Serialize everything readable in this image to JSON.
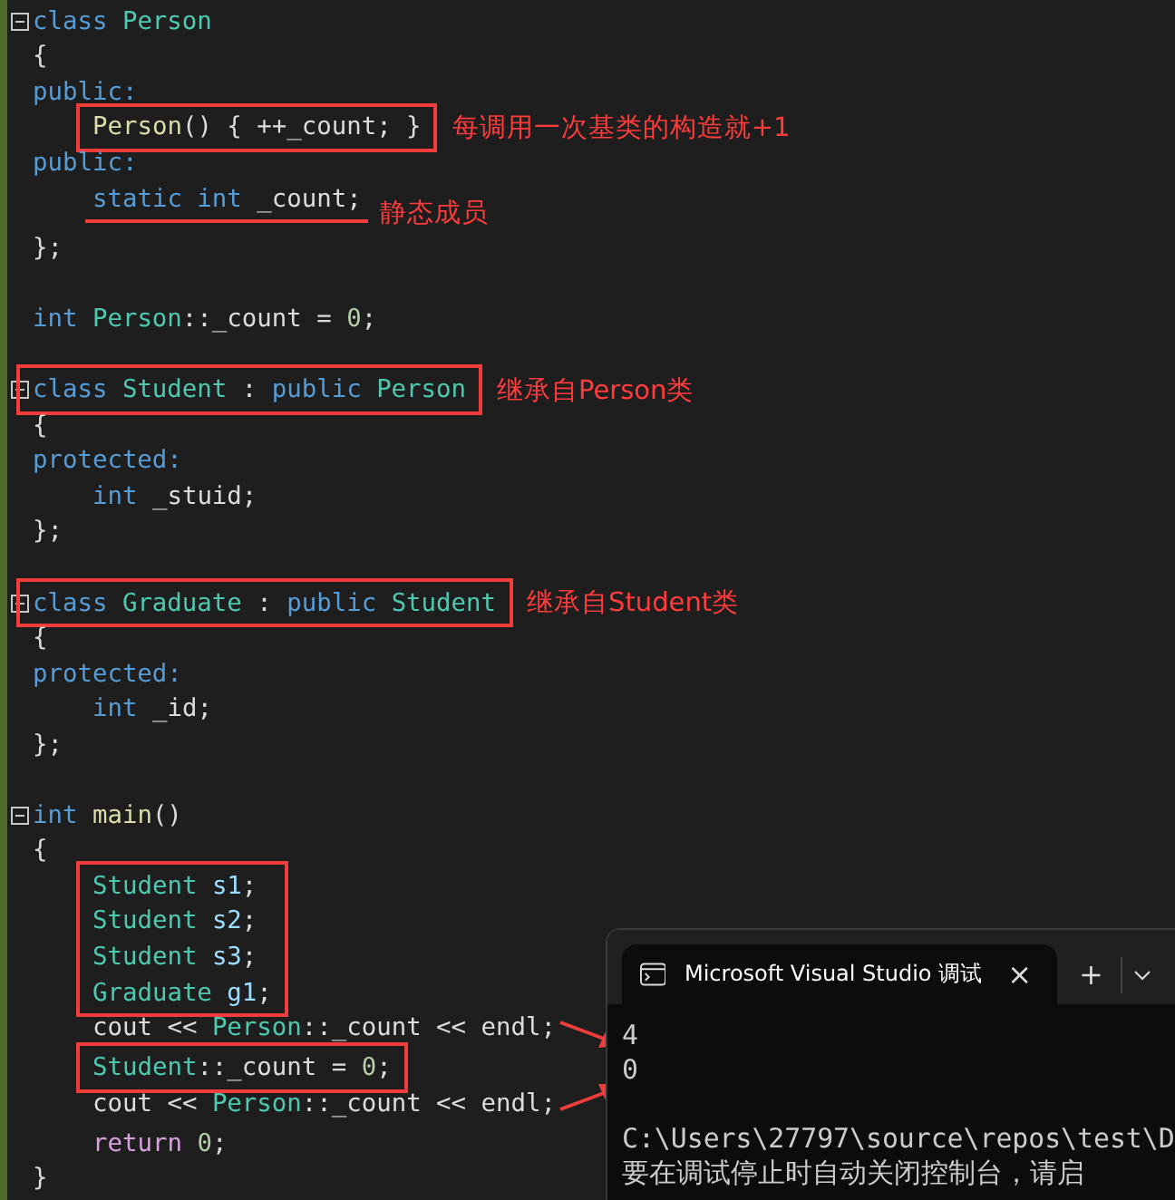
{
  "editor": {
    "lines": [
      {
        "kind": "code",
        "fold": true,
        "indented": false,
        "tokens": [
          {
            "text": "class ",
            "kind": "keyword"
          },
          {
            "text": "Person",
            "kind": "type"
          }
        ]
      },
      {
        "kind": "code",
        "indented": false,
        "tokens": [
          {
            "text": "{",
            "kind": "plain"
          }
        ]
      },
      {
        "kind": "code",
        "indented": false,
        "tokens": [
          {
            "text": "public:",
            "kind": "keyword"
          }
        ]
      },
      {
        "kind": "code",
        "indented": true,
        "boxed": true,
        "note": "每调用一次基类的构造就+1",
        "tokens": [
          {
            "text": "Person",
            "kind": "function"
          },
          {
            "text": "() { ++_count; }",
            "kind": "plain"
          }
        ]
      },
      {
        "kind": "code",
        "indented": false,
        "tokens": [
          {
            "text": "public:",
            "kind": "keyword"
          }
        ]
      },
      {
        "kind": "code",
        "indented": true,
        "underlined": true,
        "note": "静态成员",
        "tokens": [
          {
            "text": "static int ",
            "kind": "keyword"
          },
          {
            "text": "_count;",
            "kind": "plain"
          }
        ]
      },
      {
        "kind": "code",
        "indented": false,
        "tokens": [
          {
            "text": "};",
            "kind": "plain"
          }
        ]
      },
      {
        "kind": "blank"
      },
      {
        "kind": "code",
        "indented": false,
        "tokens": [
          {
            "text": "int ",
            "kind": "keyword"
          },
          {
            "text": "Person",
            "kind": "type"
          },
          {
            "text": "::_count = ",
            "kind": "plain"
          },
          {
            "text": "0",
            "kind": "number"
          },
          {
            "text": ";",
            "kind": "plain"
          }
        ]
      },
      {
        "kind": "blank"
      },
      {
        "kind": "code",
        "fold": true,
        "indented": false,
        "boxed": true,
        "note": "继承自Person类",
        "tokens": [
          {
            "text": "class ",
            "kind": "keyword"
          },
          {
            "text": "Student",
            "kind": "type"
          },
          {
            "text": " : ",
            "kind": "plain"
          },
          {
            "text": "public ",
            "kind": "keyword"
          },
          {
            "text": "Person",
            "kind": "type"
          }
        ]
      },
      {
        "kind": "code",
        "indented": false,
        "tokens": [
          {
            "text": "{",
            "kind": "plain"
          }
        ]
      },
      {
        "kind": "code",
        "indented": false,
        "tokens": [
          {
            "text": "protected:",
            "kind": "keyword"
          }
        ]
      },
      {
        "kind": "code",
        "indented": true,
        "tokens": [
          {
            "text": "int ",
            "kind": "keyword"
          },
          {
            "text": "_stuid;",
            "kind": "plain"
          }
        ]
      },
      {
        "kind": "code",
        "indented": false,
        "tokens": [
          {
            "text": "};",
            "kind": "plain"
          }
        ]
      },
      {
        "kind": "blank"
      },
      {
        "kind": "code",
        "fold": true,
        "indented": false,
        "boxed": true,
        "note": "继承自Student类",
        "tokens": [
          {
            "text": "class ",
            "kind": "keyword"
          },
          {
            "text": "Graduate",
            "kind": "type"
          },
          {
            "text": " : ",
            "kind": "plain"
          },
          {
            "text": "public ",
            "kind": "keyword"
          },
          {
            "text": "Student",
            "kind": "type"
          }
        ]
      },
      {
        "kind": "code",
        "indented": false,
        "tokens": [
          {
            "text": "{",
            "kind": "plain"
          }
        ]
      },
      {
        "kind": "code",
        "indented": false,
        "tokens": [
          {
            "text": "protected:",
            "kind": "keyword"
          }
        ]
      },
      {
        "kind": "code",
        "indented": true,
        "tokens": [
          {
            "text": "int ",
            "kind": "keyword"
          },
          {
            "text": "_id;",
            "kind": "plain"
          }
        ]
      },
      {
        "kind": "code",
        "indented": false,
        "tokens": [
          {
            "text": "};",
            "kind": "plain"
          }
        ]
      },
      {
        "kind": "blank"
      },
      {
        "kind": "code",
        "fold": true,
        "indented": false,
        "tokens": [
          {
            "text": "int ",
            "kind": "keyword"
          },
          {
            "text": "main",
            "kind": "function"
          },
          {
            "text": "()",
            "kind": "plain"
          }
        ]
      },
      {
        "kind": "code",
        "indented": false,
        "tokens": [
          {
            "text": "{",
            "kind": "plain"
          }
        ]
      },
      {
        "kind": "group",
        "indented": true,
        "boxed": true,
        "children": [
          {
            "tokens": [
              {
                "text": "Student ",
                "kind": "type"
              },
              {
                "text": "s1",
                "kind": "variable"
              },
              {
                "text": ";",
                "kind": "plain"
              }
            ]
          },
          {
            "tokens": [
              {
                "text": "Student ",
                "kind": "type"
              },
              {
                "text": "s2",
                "kind": "variable"
              },
              {
                "text": ";",
                "kind": "plain"
              }
            ]
          },
          {
            "tokens": [
              {
                "text": "Student ",
                "kind": "type"
              },
              {
                "text": "s3",
                "kind": "variable"
              },
              {
                "text": ";",
                "kind": "plain"
              }
            ]
          },
          {
            "tokens": [
              {
                "text": "Graduate ",
                "kind": "type"
              },
              {
                "text": "g1",
                "kind": "variable"
              },
              {
                "text": ";",
                "kind": "plain"
              }
            ]
          }
        ]
      },
      {
        "kind": "code",
        "indented": true,
        "arrow": true,
        "tokens": [
          {
            "text": "cout << ",
            "kind": "plain"
          },
          {
            "text": "Person",
            "kind": "type"
          },
          {
            "text": "::_count << endl;",
            "kind": "plain"
          }
        ]
      },
      {
        "kind": "code",
        "indented": true,
        "boxed": true,
        "tokens": [
          {
            "text": "Student",
            "kind": "type"
          },
          {
            "text": "::_count = ",
            "kind": "plain"
          },
          {
            "text": "0",
            "kind": "number"
          },
          {
            "text": ";",
            "kind": "plain"
          }
        ]
      },
      {
        "kind": "code",
        "indented": true,
        "arrow": true,
        "tokens": [
          {
            "text": "cout << ",
            "kind": "plain"
          },
          {
            "text": "Person",
            "kind": "type"
          },
          {
            "text": "::_count << endl;",
            "kind": "plain"
          }
        ]
      },
      {
        "kind": "code",
        "indented": true,
        "tokens": [
          {
            "text": "return ",
            "kind": "control"
          },
          {
            "text": "0",
            "kind": "number"
          },
          {
            "text": ";",
            "kind": "plain"
          }
        ]
      },
      {
        "kind": "code",
        "indented": false,
        "tokens": [
          {
            "text": "}",
            "kind": "plain"
          }
        ]
      }
    ]
  },
  "console": {
    "tab_title": "Microsoft Visual Studio 调试",
    "close": "×",
    "new_tab": "+",
    "output_blocks": [
      {
        "lines": [
          "4",
          "0"
        ]
      },
      {
        "lines": [
          "C:\\Users\\27797\\source\\repos\\test\\D",
          "要在调试停止时自动关闭控制台，请启"
        ]
      }
    ]
  }
}
